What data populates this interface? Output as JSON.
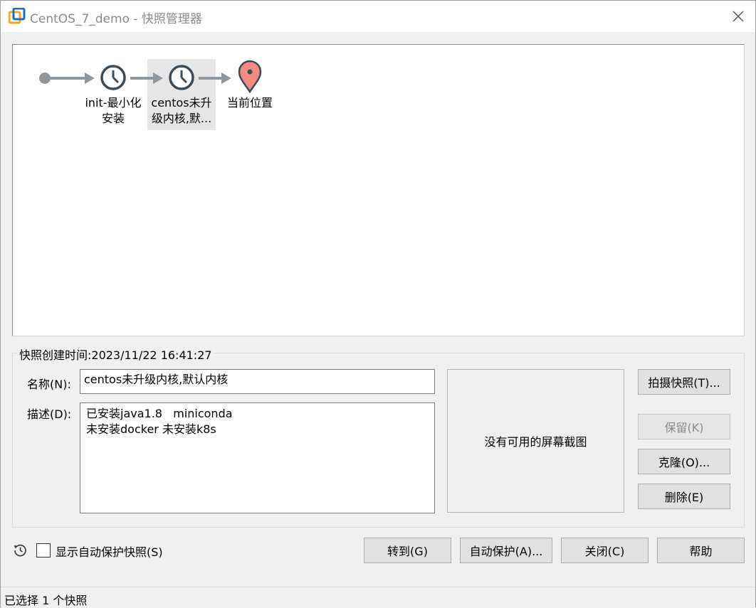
{
  "window": {
    "title": "CentOS_7_demo - 快照管理器"
  },
  "tree": {
    "nodes": [
      {
        "label_line1": "init-最小化",
        "label_line2": "安装"
      },
      {
        "label_line1": "centos未升",
        "label_line2": "级内核,默..."
      },
      {
        "label_line1": "当前位置",
        "label_line2": ""
      }
    ]
  },
  "details": {
    "created_label": "快照创建时间:2023/11/22 16:41:27",
    "name_label": "名称(N):",
    "name_value": "centos未升级内核,默认内核",
    "desc_label": "描述(D):",
    "desc_value": "已安装java1.8   miniconda\n未安装docker 未安装k8s",
    "no_screenshot": "没有可用的屏幕截图"
  },
  "side_buttons": {
    "take_snapshot": "拍摄快照(T)...",
    "keep": "保留(K)",
    "clone": "克隆(O)...",
    "delete": "删除(E)"
  },
  "footer": {
    "show_autoprotect": "显示自动保护快照(S)",
    "goto": "转到(G)",
    "autoprotect": "自动保护(A)...",
    "close": "关闭(C)",
    "help": "帮助"
  },
  "status": {
    "text": "已选择 1 个快照"
  },
  "colors": {
    "accent_orange": "#f5a623",
    "accent_blue": "#1f6fb5",
    "pin_red": "#f28b82",
    "node_dark": "#3c4a55",
    "arrow_gray": "#8f979e"
  },
  "icons": [
    "app-icon",
    "close-icon",
    "clock-icon",
    "location-pin-icon",
    "history-icon"
  ]
}
